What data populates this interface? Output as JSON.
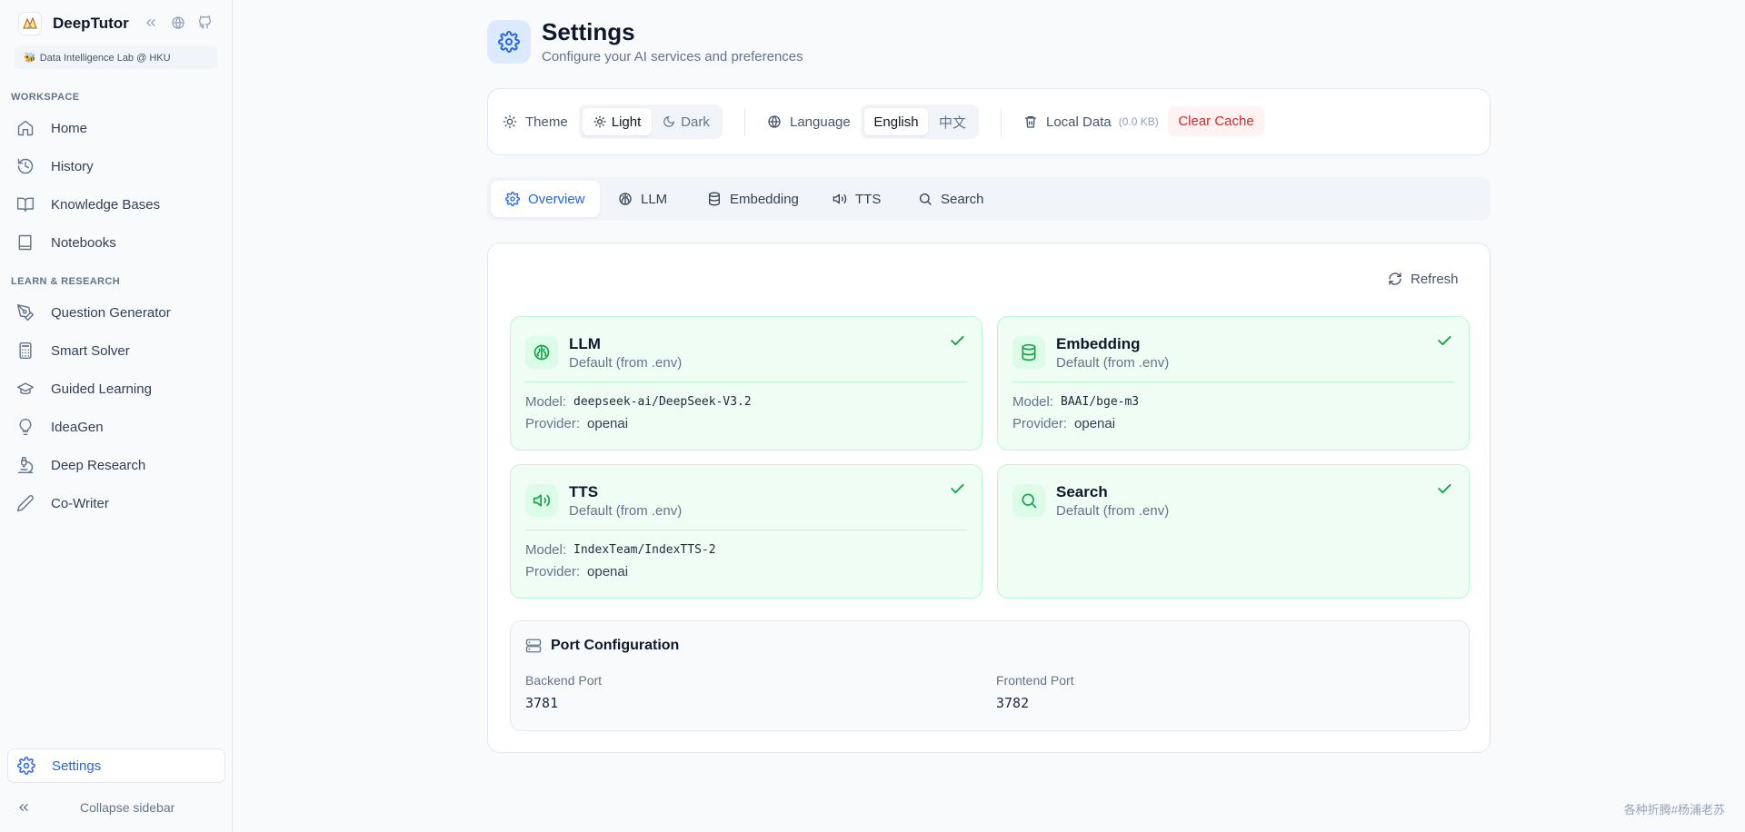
{
  "app": {
    "name": "DeepTutor",
    "lab_badge": "Data Intelligence Lab @ HKU"
  },
  "sidebar": {
    "workspace_label": "WORKSPACE",
    "workspace_items": [
      {
        "label": "Home",
        "icon": "home-icon"
      },
      {
        "label": "History",
        "icon": "history-icon"
      },
      {
        "label": "Knowledge Bases",
        "icon": "book-open-icon"
      },
      {
        "label": "Notebooks",
        "icon": "notebook-icon"
      }
    ],
    "research_label": "LEARN & RESEARCH",
    "research_items": [
      {
        "label": "Question Generator",
        "icon": "pen-tool-icon"
      },
      {
        "label": "Smart Solver",
        "icon": "calculator-icon"
      },
      {
        "label": "Guided Learning",
        "icon": "graduation-cap-icon"
      },
      {
        "label": "IdeaGen",
        "icon": "lightbulb-icon"
      },
      {
        "label": "Deep Research",
        "icon": "microscope-icon"
      },
      {
        "label": "Co-Writer",
        "icon": "pencil-icon"
      }
    ],
    "settings_label": "Settings",
    "collapse_label": "Collapse sidebar"
  },
  "header": {
    "title": "Settings",
    "subtitle": "Configure your AI services and preferences"
  },
  "preferences": {
    "theme_label": "Theme",
    "theme_options": [
      "Light",
      "Dark"
    ],
    "theme_selected": "Light",
    "language_label": "Language",
    "language_options": [
      "English",
      "中文"
    ],
    "language_selected": "English",
    "local_data_label": "Local Data",
    "local_data_size": "(0.0 KB)",
    "clear_cache_label": "Clear Cache"
  },
  "tabs": [
    "Overview",
    "LLM",
    "Embedding",
    "TTS",
    "Search"
  ],
  "active_tab": "Overview",
  "overview": {
    "refresh_label": "Refresh",
    "model_label": "Model:",
    "provider_label": "Provider:",
    "services": [
      {
        "name": "LLM",
        "source": "Default (from .env)",
        "model": "deepseek-ai/DeepSeek-V3.2",
        "provider": "openai",
        "status": "ok"
      },
      {
        "name": "Embedding",
        "source": "Default (from .env)",
        "model": "BAAI/bge-m3",
        "provider": "openai",
        "status": "ok"
      },
      {
        "name": "TTS",
        "source": "Default (from .env)",
        "model": "IndexTeam/IndexTTS-2",
        "provider": "openai",
        "status": "ok"
      },
      {
        "name": "Search",
        "source": "Default (from .env)",
        "status": "ok"
      }
    ],
    "ports": {
      "title": "Port Configuration",
      "backend_label": "Backend Port",
      "backend_value": "3781",
      "frontend_label": "Frontend Port",
      "frontend_value": "3782"
    }
  },
  "watermark": "各种折腾#杨浦老苏",
  "colors": {
    "accent": "#2563eb",
    "success": "#16a34a",
    "success_bg": "#f0fdf4",
    "danger": "#dc2626"
  }
}
